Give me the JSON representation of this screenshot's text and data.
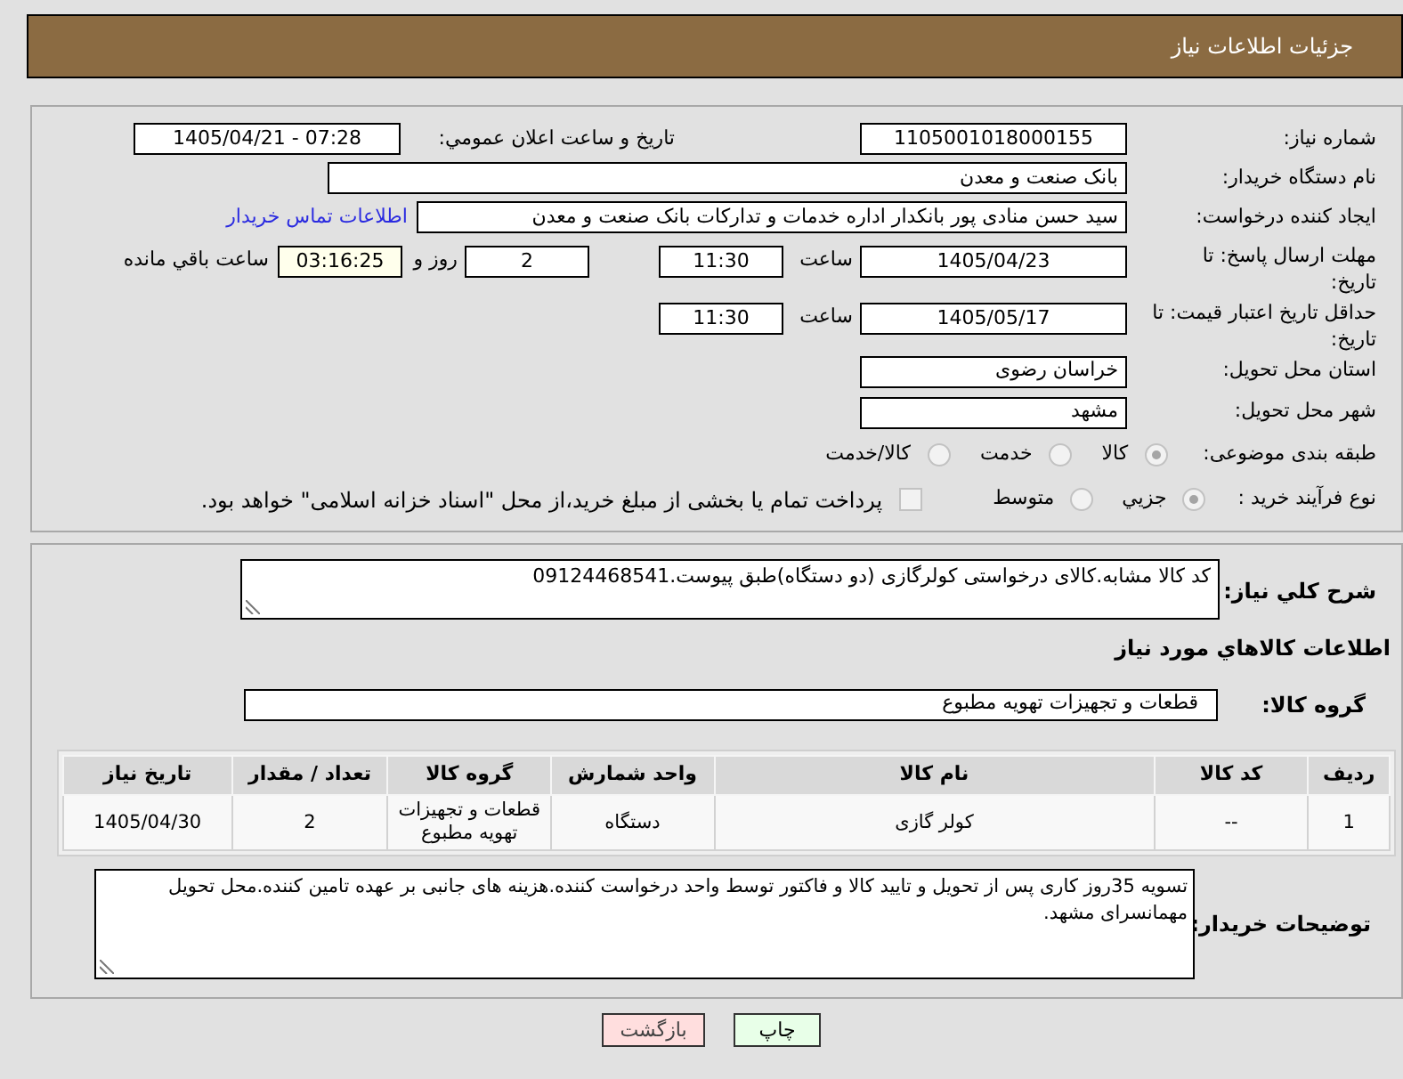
{
  "header": {
    "title": "جزئیات اطلاعات نیاز"
  },
  "details": {
    "need_number": {
      "label": "شماره نیاز:",
      "value": "1105001018000155"
    },
    "announcement": {
      "label": "تاریخ و ساعت اعلان عمومي:",
      "value": "1405/04/21 - 07:28"
    },
    "buyer_org": {
      "label": "نام دستگاه خریدار:",
      "value": "بانک صنعت و معدن"
    },
    "requester": {
      "label": "ایجاد کننده درخواست:",
      "value": "سید حسن منادی پور بانکدار اداره خدمات و تدارکات بانک صنعت و معدن",
      "link": "اطلاعات تماس خریدار"
    },
    "response_deadline": {
      "label": "مهلت ارسال پاسخ: تا تاریخ:",
      "date": "1405/04/23",
      "time_label": "ساعت",
      "time": "11:30",
      "days": "2",
      "days_label": "روز و",
      "remaining": "03:16:25",
      "remaining_label": "ساعت باقي مانده"
    },
    "price_validity": {
      "label": "حداقل تاریخ اعتبار قیمت: تا تاریخ:",
      "date": "1405/05/17",
      "time_label": "ساعت",
      "time": "11:30"
    },
    "province": {
      "label": "استان محل تحویل:",
      "value": "خراسان رضوی"
    },
    "city": {
      "label": "شهر محل تحویل:",
      "value": "مشهد"
    },
    "category": {
      "label": "طبقه بندی موضوعی:",
      "options": [
        {
          "label": "کالا",
          "selected": true,
          "disabled": true
        },
        {
          "label": "خدمت",
          "selected": false,
          "disabled": true
        },
        {
          "label": "کالا/خدمت",
          "selected": false,
          "disabled": true
        }
      ]
    },
    "process": {
      "label": "نوع فرآیند خرید :",
      "options": [
        {
          "label": "جزيي",
          "selected": true,
          "disabled": true
        },
        {
          "label": "متوسط",
          "selected": false,
          "disabled": true
        }
      ],
      "treasury": {
        "label": "پرداخت تمام یا بخشی از مبلغ خرید،از محل \"اسناد خزانه اسلامی\" خواهد بود.",
        "checked": false,
        "disabled": true
      }
    }
  },
  "description": {
    "label": "شرح کلي نياز:",
    "value": "کد کالا مشابه.کالای درخواستی کولرگازی (دو دستگاه)طبق پیوست.09124468541"
  },
  "goods": {
    "title": "اطلاعات کالاهاي مورد نياز",
    "group": {
      "label": "گروه کالا:",
      "value": "قطعات و تجهیزات تهویه مطبوع"
    },
    "table": {
      "columns": [
        "ردیف",
        "کد کالا",
        "نام کالا",
        "واحد شمارش",
        "گروه کالا",
        "تعداد / مقدار",
        "تاریخ نیاز"
      ],
      "rows": [
        [
          "1",
          "--",
          "کولر گازی",
          "دستگاه",
          "قطعات و تجهیزات تهویه مطبوع",
          "2",
          "1405/04/30"
        ]
      ]
    }
  },
  "buyer_notes": {
    "label": "توضیحات خریدار:",
    "value": "تسویه 35روز کاری پس از تحویل و تایید کالا و فاکتور توسط واحد درخواست کننده.هزینه های جانبی بر عهده تامین کننده.محل تحویل مهمانسرای مشهد."
  },
  "buttons": [
    {
      "label": "چاپ",
      "kind": "print"
    },
    {
      "label": "بازگشت",
      "kind": "back"
    }
  ]
}
